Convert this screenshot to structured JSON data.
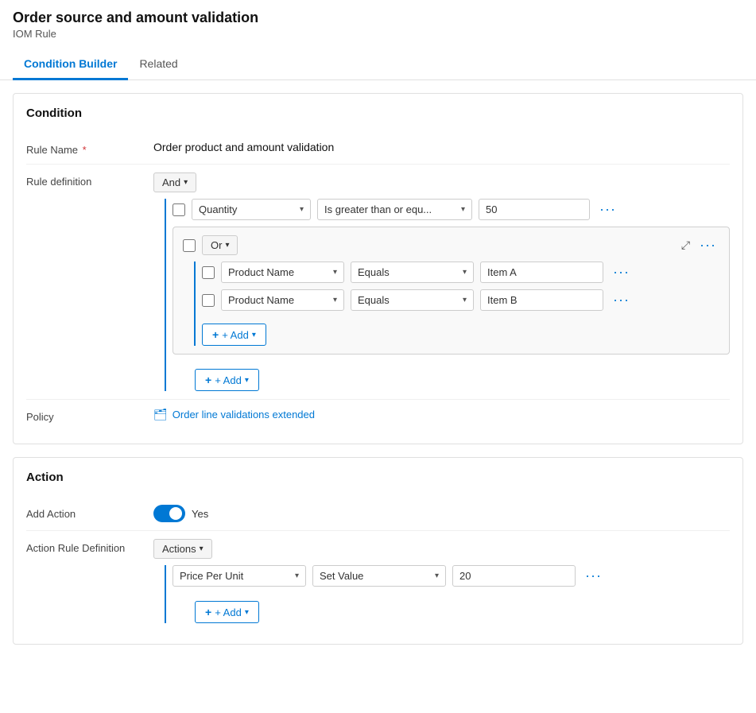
{
  "header": {
    "title": "Order source and amount validation",
    "subtitle": "IOM Rule"
  },
  "tabs": [
    {
      "id": "condition-builder",
      "label": "Condition Builder",
      "active": true
    },
    {
      "id": "related",
      "label": "Related",
      "active": false
    }
  ],
  "condition_section": {
    "title": "Condition",
    "rule_name_label": "Rule Name",
    "rule_name_required": true,
    "rule_name_value": "Order product and amount validation",
    "rule_definition_label": "Rule definition",
    "policy_label": "Policy",
    "policy_link_text": "Order line validations extended",
    "and_label": "And",
    "or_label": "Or",
    "quantity_dropdown": "Quantity",
    "quantity_operator": "Is greater than or equ...",
    "quantity_value": "50",
    "product_name_label": "Product Name",
    "equals_label": "Equals",
    "item_a_value": "Item A",
    "item_b_value": "Item B",
    "add_label": "+ Add",
    "add_label2": "+ Add",
    "collapse_icon": "⤢"
  },
  "action_section": {
    "title": "Action",
    "add_action_label": "Add Action",
    "toggle_value": "Yes",
    "action_rule_def_label": "Action Rule Definition",
    "actions_label": "Actions",
    "price_per_unit_label": "Price Per Unit",
    "set_value_label": "Set Value",
    "value": "20",
    "add_label": "+ Add"
  },
  "icons": {
    "policy": "📋",
    "chevron_down": "▾",
    "more": "•••"
  }
}
